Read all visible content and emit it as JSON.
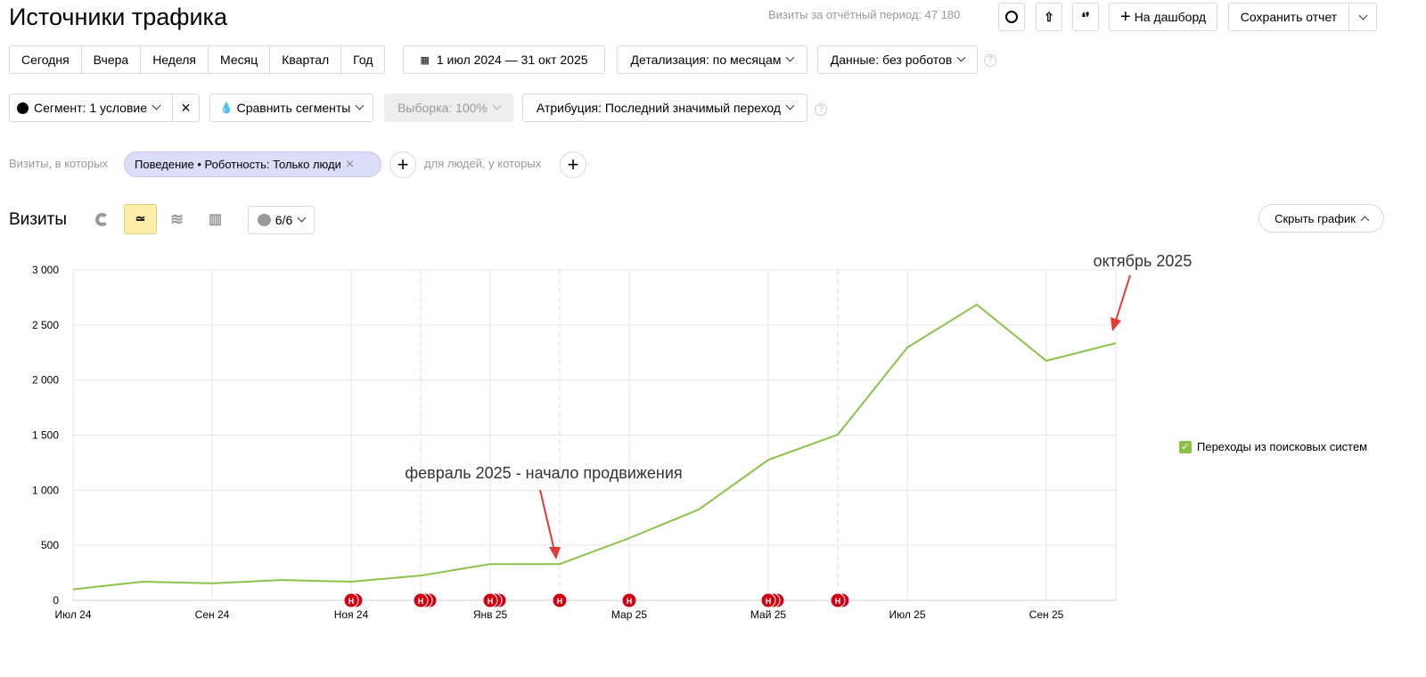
{
  "header": {
    "title": "Источники трафика",
    "visits_label": "Визиты за отчётный период: 47 180",
    "dashboard_label": "На дашборд",
    "save_label": "Сохранить отчет"
  },
  "periods": [
    "Сегодня",
    "Вчера",
    "Неделя",
    "Месяц",
    "Квартал",
    "Год"
  ],
  "date_range": "1 июл 2024 — 31 окт 2025",
  "detail": "Детализация: по месяцам",
  "data_filter": "Данные: без роботов",
  "segment": "Сегмент: 1 условие",
  "compare": "Сравнить сегменты",
  "sample": "Выборка: 100%",
  "attribution": "Атрибуция: Последний значимый переход",
  "filter": {
    "prefix": "Визиты, в которых",
    "chip": "Поведение • Роботность: Только люди",
    "people": "для людей, у которых"
  },
  "chart_header": {
    "title": "Визиты",
    "notes": "6/6",
    "hide": "Скрыть график"
  },
  "chart_data": {
    "type": "line",
    "x": [
      "Июл 24",
      "Авг 24",
      "Сен 24",
      "Окт 24",
      "Ноя 24",
      "Дек 24",
      "Янв 25",
      "Фев 25",
      "Мар 25",
      "Апр 25",
      "Май 25",
      "Июн 25",
      "Июл 25",
      "Авг 25",
      "Сен 25",
      "Окт 25"
    ],
    "xticks": [
      "Июл 24",
      "Сен 24",
      "Ноя 24",
      "Янв 25",
      "Мар 25",
      "Май 25",
      "Июл 25",
      "Сен 25"
    ],
    "yticks": [
      "0",
      "500",
      "1 000",
      "1 500",
      "2 000",
      "2 500",
      "3 000"
    ],
    "ylim": [
      0,
      3000
    ],
    "series": [
      {
        "name": "Переходы из поисковых систем",
        "color": "#8bc34a",
        "values": [
          100,
          170,
          155,
          185,
          170,
          225,
          330,
          330,
          565,
          825,
          1275,
          1505,
          2295,
          2685,
          2175,
          2335
        ]
      }
    ],
    "note_markers": [
      {
        "month": "Ноя 24",
        "count": 2
      },
      {
        "month": "Дек 24",
        "count": 3
      },
      {
        "month": "Янв 25",
        "count": 3
      },
      {
        "month": "Фев 25",
        "count": 1
      },
      {
        "month": "Мар 25",
        "count": 1
      },
      {
        "month": "Май 25",
        "count": 3
      },
      {
        "month": "Июн 25",
        "count": 2
      }
    ],
    "note_letter": "Н",
    "annotations": [
      {
        "text": "февраль 2025 - начало продвижения",
        "month": "Фев 25"
      },
      {
        "text": "октябрь 2025",
        "month": "Окт 25"
      }
    ],
    "legend": "top-right"
  }
}
